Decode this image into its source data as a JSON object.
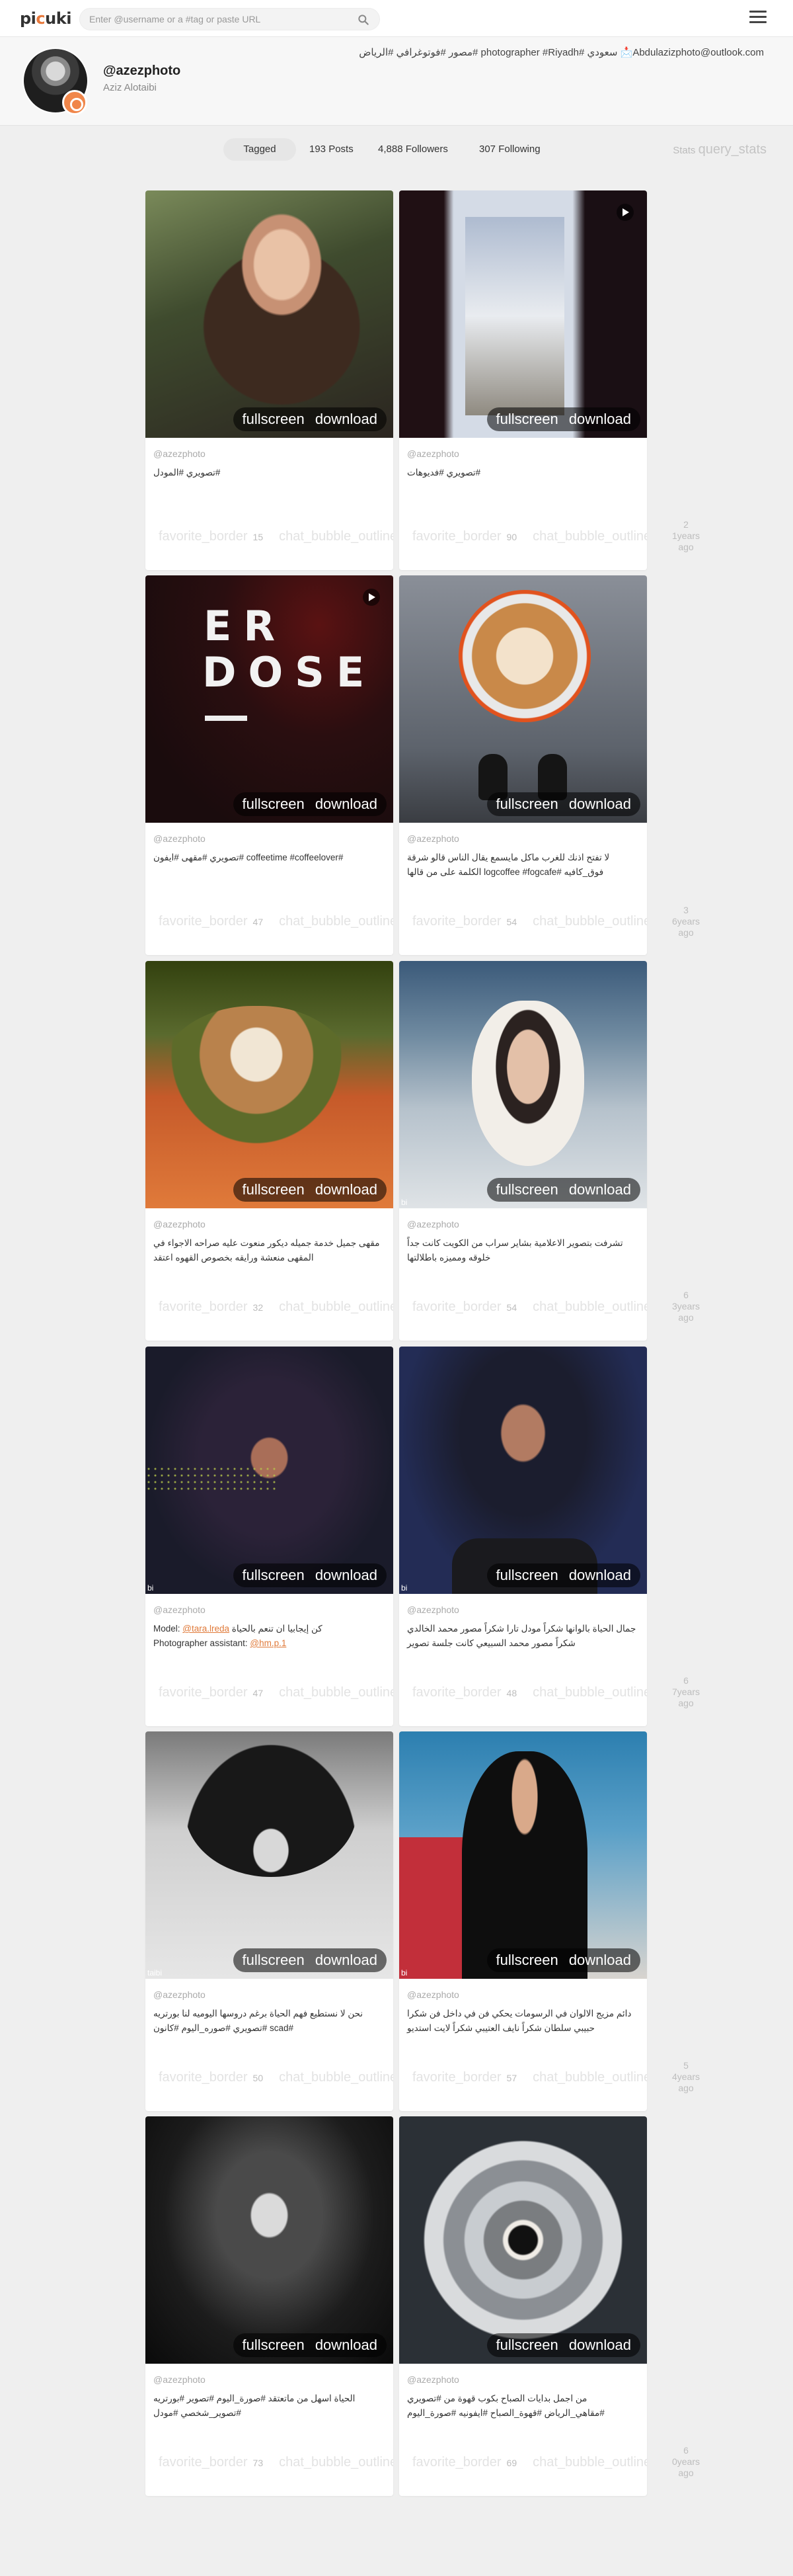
{
  "header": {
    "logo_pre": "pi",
    "logo_accent": "c",
    "logo_post": "uki",
    "search_placeholder": "Enter @username or a #tag or paste URL"
  },
  "profile": {
    "username": "@azezphoto",
    "fullname": "Aziz Alotaibi",
    "bio": "Abdulazizphoto@outlook.com📩 سعودي #photographer #Riyadh #مصور #فوتوغرافي #الرياض"
  },
  "stats": {
    "tab": "Tagged",
    "posts": "193 Posts",
    "followers": "4,888 Followers",
    "following": "307 Following",
    "stats_label": "Stats",
    "stats_link": "query_stats"
  },
  "footer_labels": {
    "likes": "favorite_border",
    "comments": "chat_bubble_outline"
  },
  "actions": {
    "fullscreen": "fullscreen",
    "download": "download"
  },
  "posts": [
    {
      "owner": "@azezphoto",
      "caption": "#تصويري #المودل",
      "likes": "15"
    },
    {
      "owner": "@azezphoto",
      "caption": "#تصويري #فديوهات",
      "likes": "90"
    },
    {
      "owner": "@azezphoto",
      "caption": "#coffeetime #coffeelover #تصويري #مقهى #ايفون",
      "likes": "47",
      "overlay_line1": "ER",
      "overlay_line2": "DOSE"
    },
    {
      "owner": "@azezphoto",
      "caption": "لا تفتح اذنك للغرب ماكل مايسمع يقال الناس قالو شرقة فوق_كافيه #logcoffee #fogcafe الكلمة على من قالها",
      "likes": "54"
    },
    {
      "owner": "@azezphoto",
      "caption": "مقهى جميل خدمة جميله ديكور منعوت عليه صراحه الاجواء في المقهى منعشة ورايقه بخصوص القهوه اعتقد",
      "likes": "32"
    },
    {
      "owner": "@azezphoto",
      "caption": "تشرفت بتصوير الاعلامية بشاير سراب من الكويت كانت جداً خلوقه ومميزه باطلالتها",
      "likes": "54"
    },
    {
      "owner": "@azezphoto",
      "caption_text": "كن إيجابيا ان تنعم بالحياة Model:",
      "caption_mention1": "@tara.lreda",
      "caption_text2": "Photographer assistant:",
      "caption_mention2": "@hm.p.1",
      "likes": "47",
      "watermark": "bi"
    },
    {
      "owner": "@azezphoto",
      "caption": "جمال الحياة بالوانها شكراً مودل تارا شكراً مصور محمد الخالدي شكراً مصور محمد السبيعي كانت جلسة تصوير",
      "likes": "48",
      "watermark": "bi"
    },
    {
      "owner": "@azezphoto",
      "caption": "نحن لا نستطيع فهم الحياة برغم دروسها اليوميه لنا بورتريه #scad #تصويري #صوره_اليوم #كانون",
      "likes": "50",
      "watermark": "taibi"
    },
    {
      "owner": "@azezphoto",
      "caption": "دائم مزيج الالوان في الرسومات يحكي فن في داخل فن شكرا حبيبي سلطان شكراً نايف العتيبي شكراً لايت استديو",
      "likes": "57",
      "watermark": "bi"
    },
    {
      "owner": "@azezphoto",
      "caption": "الحياة اسهل من ماتعتقد #صورة_اليوم #تصوير #بورتريه #تصوير_شخصي #مودل",
      "likes": "73"
    },
    {
      "owner": "@azezphoto",
      "caption": "من اجمل بدايات الصباح بكوب قهوة من #تصويري #مقاهي_الرياض #قهوة_الصباح #ايفونيه #صورة_اليوم",
      "likes": "69"
    }
  ],
  "side_info": [
    {
      "count": "2",
      "age": "1years ago"
    },
    {
      "count": "3",
      "age": "6years ago"
    },
    {
      "count": "6",
      "age": "3years ago"
    },
    {
      "count": "6",
      "age": "7years ago"
    },
    {
      "count": "5",
      "age": "4years ago"
    },
    {
      "count": "6",
      "age": "0years ago"
    }
  ]
}
